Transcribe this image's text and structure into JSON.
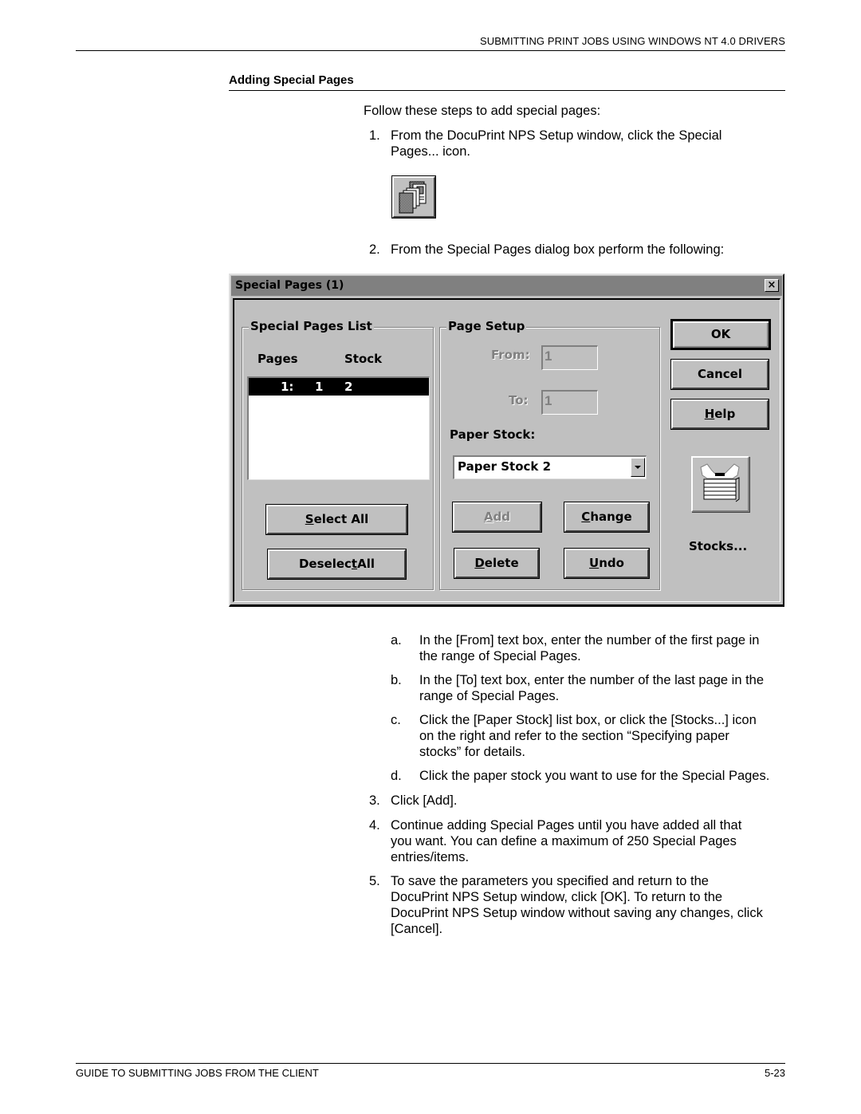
{
  "header": {
    "running_title": "SUBMITTING PRINT JOBS USING WINDOWS NT 4.0 DRIVERS"
  },
  "section": {
    "title": "Adding Special Pages"
  },
  "intro": "Follow these steps to add special pages:",
  "steps": [
    {
      "num": "1.",
      "lines": [
        "From the DocuPrint NPS Setup window, click the Special",
        "Pages... icon."
      ]
    },
    {
      "num": "2.",
      "lines": [
        "From the Special Pages dialog box perform the following:"
      ]
    },
    {
      "num": "3.",
      "lines": [
        "Click [Add]."
      ]
    },
    {
      "num": "4.",
      "lines": [
        "Continue adding Special Pages until you have added all that",
        "you want. You can define a maximum of 250 Special Pages",
        "entries/items."
      ]
    },
    {
      "num": "5.",
      "lines": [
        "To save the parameters you specified and return to the",
        "DocuPrint NPS Setup window, click [OK]. To return to the",
        "DocuPrint NPS Setup window without saving any changes, click",
        "[Cancel]."
      ]
    }
  ],
  "substeps": [
    {
      "num": "a.",
      "lines": [
        "In the [From] text box, enter the number of the first page in",
        "the range of Special Pages."
      ]
    },
    {
      "num": "b.",
      "lines": [
        "In the [To] text box, enter the number of the last page in the",
        "range of Special Pages."
      ]
    },
    {
      "num": "c.",
      "lines": [
        "Click the [Paper Stock] list box, or click the [Stocks...] icon",
        "on the right and refer to the section “Specifying paper",
        "stocks” for details."
      ]
    },
    {
      "num": "d.",
      "lines": [
        "Click the paper stock you want to use for the Special Pages."
      ]
    }
  ],
  "special_pages_icon": {
    "icon": "special-pages-icon"
  },
  "dialog": {
    "title": "Special Pages (1)",
    "close_label": "×",
    "list_group": {
      "legend": "Special Pages List",
      "col_pages": "Pages",
      "col_stock": "Stock",
      "rows": [
        {
          "index": "1:",
          "pages": "1",
          "stock": "2",
          "selected": true
        }
      ],
      "select_all": {
        "pre": "",
        "mnemonic": "S",
        "post": "elect All"
      },
      "deselect_all": {
        "pre": "Deselec",
        "mnemonic": "t",
        "post": " All"
      }
    },
    "setup_group": {
      "legend": "Page Setup",
      "from_label": "From:",
      "from_value": "1",
      "to_label": "To:",
      "to_value": "1",
      "paper_stock_label": "Paper Stock:",
      "paper_stock_value": "Paper Stock 2",
      "add": {
        "pre": "",
        "mnemonic": "A",
        "post": "dd",
        "disabled": true
      },
      "change": {
        "pre": "",
        "mnemonic": "C",
        "post": "hange"
      },
      "delete": {
        "pre": "",
        "mnemonic": "D",
        "post": "elete"
      },
      "undo": {
        "pre": "",
        "mnemonic": "U",
        "post": "ndo"
      }
    },
    "ok_label": "OK",
    "cancel_label": "Cancel",
    "help": {
      "pre": "",
      "mnemonic": "H",
      "post": "elp"
    },
    "stocks_label": "Stocks..."
  },
  "footer": {
    "left": "GUIDE TO SUBMITTING JOBS FROM THE CLIENT",
    "right": "5-23"
  }
}
